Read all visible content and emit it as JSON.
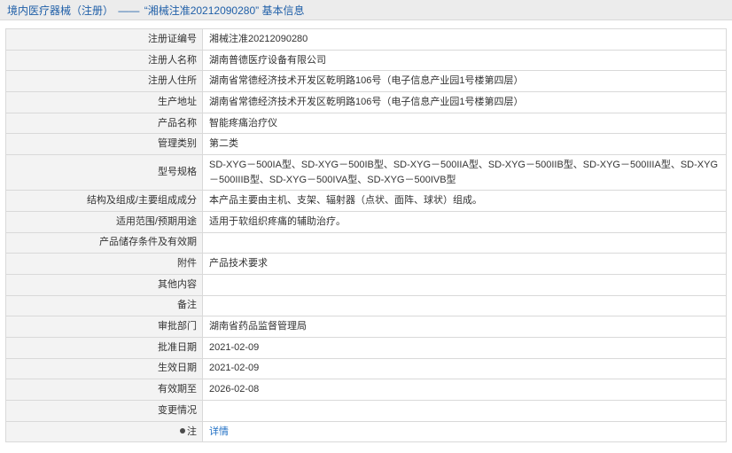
{
  "breadcrumb": {
    "parent": "境内医疗器械（注册）",
    "separator": "——",
    "current": "“湘械注准20212090280” 基本信息"
  },
  "fields": [
    {
      "label": "注册证编号",
      "value": "湘械注准20212090280"
    },
    {
      "label": "注册人名称",
      "value": "湖南普德医疗设备有限公司"
    },
    {
      "label": "注册人住所",
      "value": "湖南省常德经济技术开发区乾明路106号（电子信息产业园1号楼第四层）"
    },
    {
      "label": "生产地址",
      "value": "湖南省常德经济技术开发区乾明路106号（电子信息产业园1号楼第四层）"
    },
    {
      "label": "产品名称",
      "value": "智能疼痛治疗仪"
    },
    {
      "label": "管理类别",
      "value": "第二类"
    },
    {
      "label": "型号规格",
      "value": "SD-XYG－500IA型、SD-XYG－500IB型、SD-XYG－500IIA型、SD-XYG－500IIB型、SD-XYG－500IIIA型、SD-XYG－500IIIB型、SD-XYG－500IVA型、SD-XYG－500IVB型"
    },
    {
      "label": "结构及组成/主要组成成分",
      "value": "本产品主要由主机、支架、辐射器（点状、面阵、球状）组成。"
    },
    {
      "label": "适用范围/预期用途",
      "value": "适用于软组织疼痛的辅助治疗。"
    },
    {
      "label": "产品储存条件及有效期",
      "value": ""
    },
    {
      "label": "附件",
      "value": "产品技术要求"
    },
    {
      "label": "其他内容",
      "value": ""
    },
    {
      "label": "备注",
      "value": ""
    },
    {
      "label": "审批部门",
      "value": "湖南省药品监督管理局"
    },
    {
      "label": "批准日期",
      "value": "2021-02-09"
    },
    {
      "label": "生效日期",
      "value": "2021-02-09"
    },
    {
      "label": "有效期至",
      "value": "2026-02-08"
    },
    {
      "label": "变更情况",
      "value": ""
    },
    {
      "label": "注",
      "value": "详情"
    }
  ]
}
